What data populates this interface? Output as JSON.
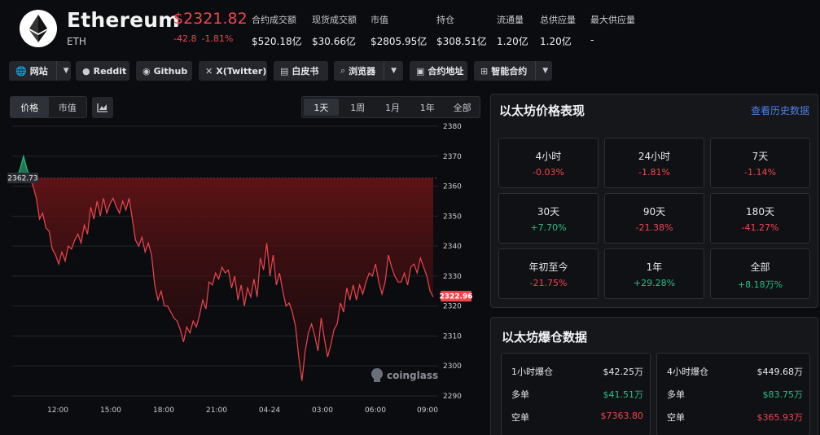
{
  "coin": {
    "name": "Ethereum",
    "symbol": "ETH",
    "price": "$2321.82",
    "change_abs": "-42.8",
    "change_pct": "-1.81%"
  },
  "stats": [
    {
      "label": "合约成交额",
      "value": "$520.18亿"
    },
    {
      "label": "现货成交额",
      "value": "$30.66亿"
    },
    {
      "label": "市值",
      "value": "$2805.95亿"
    },
    {
      "label": "持仓",
      "value": "$308.51亿"
    },
    {
      "label": "流通量",
      "value": "1.20亿"
    },
    {
      "label": "总供应量",
      "value": "1.20亿"
    },
    {
      "label": "最大供应量",
      "value": "-"
    }
  ],
  "links": {
    "website": "网站",
    "reddit": "Reddit",
    "github": "Github",
    "twitter": "X(Twitter)",
    "whitepaper": "白皮书",
    "explorer": "浏览器",
    "contract_address": "合约地址",
    "smart_contract": "智能合约"
  },
  "chart_toggle": {
    "price": "价格",
    "mcap": "市值",
    "active": "价格"
  },
  "ranges": [
    "1天",
    "1周",
    "1月",
    "1年",
    "全部"
  ],
  "active_range": "1天",
  "watermark": "coinglass",
  "chart_data": {
    "type": "area",
    "y_ticks": [
      2380,
      2370,
      2360,
      2350,
      2340,
      2330,
      2320,
      2310,
      2300,
      2290
    ],
    "x_ticks": [
      "12:00",
      "15:00",
      "18:00",
      "21:00",
      "04-24",
      "03:00",
      "06:00",
      "09:00"
    ],
    "ylim": [
      2287,
      2382
    ],
    "reference_price": 2362.73,
    "reference_label": "2362.73",
    "last_label": "2322.96",
    "grid": true,
    "values": [
      2362.7,
      2366,
      2370,
      2366,
      2362.7,
      2360,
      2356,
      2349,
      2351,
      2346,
      2345,
      2339,
      2337,
      2334,
      2338,
      2335,
      2340,
      2339,
      2342,
      2344,
      2341,
      2347,
      2344,
      2353,
      2349,
      2355,
      2350,
      2356,
      2351,
      2354,
      2356,
      2353,
      2351,
      2355,
      2352,
      2356,
      2349,
      2342,
      2340,
      2343,
      2338,
      2341,
      2337,
      2327,
      2322,
      2325,
      2320,
      2320,
      2318,
      2316,
      2315,
      2312,
      2308,
      2313,
      2311,
      2315,
      2313,
      2317,
      2322,
      2319,
      2328,
      2327,
      2331,
      2329,
      2333,
      2331,
      2332,
      2326,
      2330,
      2322,
      2327,
      2320,
      2326,
      2323,
      2329,
      2323,
      2336,
      2332,
      2341,
      2330,
      2337,
      2327,
      2331,
      2325,
      2320,
      2321,
      2318,
      2313,
      2303,
      2295,
      2305,
      2311,
      2314,
      2310,
      2305,
      2316,
      2309,
      2303,
      2307,
      2312,
      2314,
      2321,
      2318,
      2326,
      2322,
      2327,
      2322,
      2327,
      2324,
      2328,
      2331,
      2330,
      2334,
      2328,
      2324,
      2328,
      2337,
      2333,
      2330,
      2328,
      2328,
      2331,
      2327,
      2333,
      2334,
      2331,
      2336,
      2333,
      2330,
      2325,
      2323
    ]
  },
  "performance": {
    "title": "以太坊价格表现",
    "link": "查看历史数据",
    "items": [
      {
        "label": "4小时",
        "value": "-0.03%",
        "dir": "down"
      },
      {
        "label": "24小时",
        "value": "-1.81%",
        "dir": "down"
      },
      {
        "label": "7天",
        "value": "-1.14%",
        "dir": "down"
      },
      {
        "label": "30天",
        "value": "+7.70%",
        "dir": "up"
      },
      {
        "label": "90天",
        "value": "-21.38%",
        "dir": "down"
      },
      {
        "label": "180天",
        "value": "-41.27%",
        "dir": "down"
      },
      {
        "label": "年初至今",
        "value": "-21.75%",
        "dir": "down"
      },
      {
        "label": "1年",
        "value": "+29.28%",
        "dir": "up"
      },
      {
        "label": "全部",
        "value": "+8.18万%",
        "dir": "up"
      }
    ]
  },
  "liquidation": {
    "title": "以太坊爆仓数据",
    "blocks": [
      {
        "period": "1小时爆仓",
        "total": "$42.25万",
        "long_label": "多单",
        "long": "$41.51万",
        "short_label": "空单",
        "short": "$7363.80"
      },
      {
        "period": "4小时爆仓",
        "total": "$449.68万",
        "long_label": "多单",
        "long": "$83.75万",
        "short_label": "空单",
        "short": "$365.93万"
      }
    ]
  },
  "colors": {
    "down": "#f0464e",
    "up": "#2ebd85",
    "link": "#4f7fe6",
    "background": "#0b0c0f"
  }
}
